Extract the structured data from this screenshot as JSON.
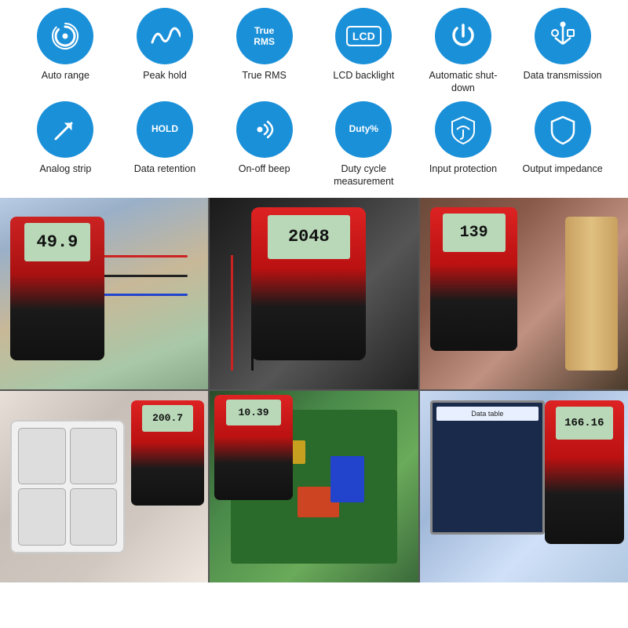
{
  "features": {
    "row1": [
      {
        "id": "auto-range",
        "label": "Auto range",
        "icon": "spiral"
      },
      {
        "id": "peak-hold",
        "label": "Peak hold",
        "icon": "wave"
      },
      {
        "id": "true-rms",
        "label": "True RMS",
        "icon": "text-truerms"
      },
      {
        "id": "lcd-backlight",
        "label": "LCD backlight",
        "icon": "lcd"
      },
      {
        "id": "auto-shutdown",
        "label": "Automatic shut-down",
        "icon": "power"
      },
      {
        "id": "data-transmission",
        "label": "Data transmission",
        "icon": "usb"
      }
    ],
    "row2": [
      {
        "id": "analog-strip",
        "label": "Analog strip",
        "icon": "arrow"
      },
      {
        "id": "data-retention",
        "label": "Data retention",
        "icon": "hold"
      },
      {
        "id": "onoff-beep",
        "label": "On-off beep",
        "icon": "sound"
      },
      {
        "id": "duty-cycle",
        "label": "Duty cycle measurement",
        "icon": "duty"
      },
      {
        "id": "input-protection",
        "label": "Input protection",
        "icon": "shield"
      },
      {
        "id": "output-impedance",
        "label": "Output impedance",
        "icon": "shield2"
      }
    ]
  },
  "photos": {
    "readings": [
      "49.9",
      "2048",
      "139",
      "200.7",
      "10.39",
      "166.16"
    ],
    "alt_texts": [
      "Multimeter measuring in electrical panel",
      "Multimeter measuring motor circuit",
      "Multimeter with temperature probe",
      "Multimeter with power supply",
      "Multimeter on circuit board",
      "Multimeter with computer display"
    ]
  }
}
